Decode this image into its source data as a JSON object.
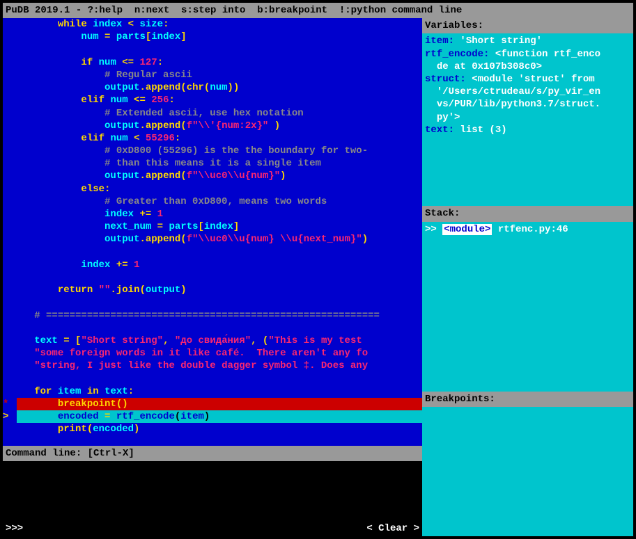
{
  "header": "PuDB 2019.1 - ?:help  n:next  s:step into  b:breakpoint  !:python command line",
  "code": {
    "lines": [
      {
        "indent": "       ",
        "tokens": [
          {
            "c": "kw",
            "t": "while"
          },
          {
            "c": "white",
            "t": " "
          },
          {
            "c": "name",
            "t": "index"
          },
          {
            "c": "white",
            "t": " "
          },
          {
            "c": "op",
            "t": "<"
          },
          {
            "c": "white",
            "t": " "
          },
          {
            "c": "name",
            "t": "size"
          },
          {
            "c": "op",
            "t": ":"
          }
        ]
      },
      {
        "indent": "           ",
        "tokens": [
          {
            "c": "name",
            "t": "num"
          },
          {
            "c": "white",
            "t": " "
          },
          {
            "c": "op",
            "t": "="
          },
          {
            "c": "white",
            "t": " "
          },
          {
            "c": "name",
            "t": "parts"
          },
          {
            "c": "bracket",
            "t": "["
          },
          {
            "c": "name",
            "t": "index"
          },
          {
            "c": "bracket",
            "t": "]"
          }
        ]
      },
      {
        "indent": "",
        "tokens": []
      },
      {
        "indent": "           ",
        "tokens": [
          {
            "c": "kw",
            "t": "if"
          },
          {
            "c": "white",
            "t": " "
          },
          {
            "c": "name",
            "t": "num"
          },
          {
            "c": "white",
            "t": " "
          },
          {
            "c": "op",
            "t": "<="
          },
          {
            "c": "white",
            "t": " "
          },
          {
            "c": "num",
            "t": "127"
          },
          {
            "c": "op",
            "t": ":"
          }
        ]
      },
      {
        "indent": "               ",
        "tokens": [
          {
            "c": "comment",
            "t": "# Regular ascii"
          }
        ]
      },
      {
        "indent": "               ",
        "tokens": [
          {
            "c": "name",
            "t": "output"
          },
          {
            "c": "op",
            "t": "."
          },
          {
            "c": "func",
            "t": "append"
          },
          {
            "c": "paren",
            "t": "("
          },
          {
            "c": "func",
            "t": "chr"
          },
          {
            "c": "paren",
            "t": "("
          },
          {
            "c": "name",
            "t": "num"
          },
          {
            "c": "paren",
            "t": ")"
          },
          {
            "c": "paren",
            "t": ")"
          }
        ]
      },
      {
        "indent": "           ",
        "tokens": [
          {
            "c": "kw",
            "t": "elif"
          },
          {
            "c": "white",
            "t": " "
          },
          {
            "c": "name",
            "t": "num"
          },
          {
            "c": "white",
            "t": " "
          },
          {
            "c": "op",
            "t": "<="
          },
          {
            "c": "white",
            "t": " "
          },
          {
            "c": "num",
            "t": "256"
          },
          {
            "c": "op",
            "t": ":"
          }
        ]
      },
      {
        "indent": "               ",
        "tokens": [
          {
            "c": "comment",
            "t": "# Extended ascii, use hex notation"
          }
        ]
      },
      {
        "indent": "               ",
        "tokens": [
          {
            "c": "name",
            "t": "output"
          },
          {
            "c": "op",
            "t": "."
          },
          {
            "c": "func",
            "t": "append"
          },
          {
            "c": "paren",
            "t": "("
          },
          {
            "c": "str",
            "t": "f\"\\\\'{num:2x}\" "
          },
          {
            "c": "paren",
            "t": ")"
          }
        ]
      },
      {
        "indent": "           ",
        "tokens": [
          {
            "c": "kw",
            "t": "elif"
          },
          {
            "c": "white",
            "t": " "
          },
          {
            "c": "name",
            "t": "num"
          },
          {
            "c": "white",
            "t": " "
          },
          {
            "c": "op",
            "t": "<"
          },
          {
            "c": "white",
            "t": " "
          },
          {
            "c": "num",
            "t": "55296"
          },
          {
            "c": "op",
            "t": ":"
          }
        ]
      },
      {
        "indent": "               ",
        "tokens": [
          {
            "c": "comment",
            "t": "# 0xD800 (55296) is the the boundary for two-"
          }
        ]
      },
      {
        "indent": "               ",
        "tokens": [
          {
            "c": "comment",
            "t": "# than this means it is a single item"
          }
        ]
      },
      {
        "indent": "               ",
        "tokens": [
          {
            "c": "name",
            "t": "output"
          },
          {
            "c": "op",
            "t": "."
          },
          {
            "c": "func",
            "t": "append"
          },
          {
            "c": "paren",
            "t": "("
          },
          {
            "c": "str",
            "t": "f\"\\\\uc0\\\\u{num}\""
          },
          {
            "c": "paren",
            "t": ")"
          }
        ]
      },
      {
        "indent": "           ",
        "tokens": [
          {
            "c": "kw",
            "t": "else"
          },
          {
            "c": "op",
            "t": ":"
          }
        ]
      },
      {
        "indent": "               ",
        "tokens": [
          {
            "c": "comment",
            "t": "# Greater than 0xD800, means two words"
          }
        ]
      },
      {
        "indent": "               ",
        "tokens": [
          {
            "c": "name",
            "t": "index"
          },
          {
            "c": "white",
            "t": " "
          },
          {
            "c": "op",
            "t": "+="
          },
          {
            "c": "white",
            "t": " "
          },
          {
            "c": "num",
            "t": "1"
          }
        ]
      },
      {
        "indent": "               ",
        "tokens": [
          {
            "c": "name",
            "t": "next_num"
          },
          {
            "c": "white",
            "t": " "
          },
          {
            "c": "op",
            "t": "="
          },
          {
            "c": "white",
            "t": " "
          },
          {
            "c": "name",
            "t": "parts"
          },
          {
            "c": "bracket",
            "t": "["
          },
          {
            "c": "name",
            "t": "index"
          },
          {
            "c": "bracket",
            "t": "]"
          }
        ]
      },
      {
        "indent": "               ",
        "tokens": [
          {
            "c": "name",
            "t": "output"
          },
          {
            "c": "op",
            "t": "."
          },
          {
            "c": "func",
            "t": "append"
          },
          {
            "c": "paren",
            "t": "("
          },
          {
            "c": "str",
            "t": "f\"\\\\uc0\\\\u{num} \\\\u{next_num}\""
          },
          {
            "c": "paren",
            "t": ")"
          }
        ]
      },
      {
        "indent": "",
        "tokens": []
      },
      {
        "indent": "           ",
        "tokens": [
          {
            "c": "name",
            "t": "index"
          },
          {
            "c": "white",
            "t": " "
          },
          {
            "c": "op",
            "t": "+="
          },
          {
            "c": "white",
            "t": " "
          },
          {
            "c": "num",
            "t": "1"
          }
        ]
      },
      {
        "indent": "",
        "tokens": []
      },
      {
        "indent": "       ",
        "tokens": [
          {
            "c": "kw",
            "t": "return"
          },
          {
            "c": "white",
            "t": " "
          },
          {
            "c": "str",
            "t": "\"\""
          },
          {
            "c": "op",
            "t": "."
          },
          {
            "c": "func",
            "t": "join"
          },
          {
            "c": "paren",
            "t": "("
          },
          {
            "c": "name",
            "t": "output"
          },
          {
            "c": "paren",
            "t": ")"
          }
        ]
      },
      {
        "indent": "",
        "tokens": []
      },
      {
        "indent": "   ",
        "tokens": [
          {
            "c": "comment",
            "t": "# ========================================================="
          }
        ]
      },
      {
        "indent": "",
        "tokens": []
      },
      {
        "indent": "   ",
        "tokens": [
          {
            "c": "name",
            "t": "text"
          },
          {
            "c": "white",
            "t": " "
          },
          {
            "c": "op",
            "t": "="
          },
          {
            "c": "white",
            "t": " "
          },
          {
            "c": "bracket",
            "t": "["
          },
          {
            "c": "str",
            "t": "\"Short string\""
          },
          {
            "c": "op",
            "t": ","
          },
          {
            "c": "white",
            "t": " "
          },
          {
            "c": "str",
            "t": "\"до свида́ния\""
          },
          {
            "c": "op",
            "t": ","
          },
          {
            "c": "white",
            "t": " "
          },
          {
            "c": "paren",
            "t": "("
          },
          {
            "c": "str",
            "t": "\"This is my test "
          }
        ]
      },
      {
        "indent": "   ",
        "tokens": [
          {
            "c": "str",
            "t": "\"some foreign words in it like café.  There aren't any fo"
          }
        ]
      },
      {
        "indent": "   ",
        "tokens": [
          {
            "c": "str",
            "t": "\"string, I just like the double dagger symbol ‡. Does any"
          }
        ]
      },
      {
        "indent": "",
        "tokens": []
      },
      {
        "indent": "   ",
        "tokens": [
          {
            "c": "kw",
            "t": "for"
          },
          {
            "c": "white",
            "t": " "
          },
          {
            "c": "name",
            "t": "item"
          },
          {
            "c": "white",
            "t": " "
          },
          {
            "c": "kw",
            "t": "in"
          },
          {
            "c": "white",
            "t": " "
          },
          {
            "c": "name",
            "t": "text"
          },
          {
            "c": "op",
            "t": ":"
          }
        ]
      },
      {
        "indent": "       ",
        "gutter": "*",
        "gclass": "gutter-bp",
        "lineclass": "line-bp",
        "tokens": [
          {
            "c": "func",
            "t": "breakpoint"
          },
          {
            "c": "paren",
            "t": "()"
          }
        ]
      },
      {
        "indent": "       ",
        "gutter": ">",
        "gclass": "gutter-cur",
        "lineclass": "line-cur",
        "tokens": [
          {
            "c": "name",
            "t": "encoded"
          },
          {
            "c": "white",
            "t": " "
          },
          {
            "c": "op",
            "t": "="
          },
          {
            "c": "white",
            "t": " "
          },
          {
            "c": "name",
            "t": "rtf_encode"
          },
          {
            "c": "paren",
            "t": "("
          },
          {
            "c": "name",
            "t": "item"
          },
          {
            "c": "paren",
            "t": ")"
          }
        ]
      },
      {
        "indent": "       ",
        "tokens": [
          {
            "c": "func",
            "t": "print"
          },
          {
            "c": "paren",
            "t": "("
          },
          {
            "c": "name",
            "t": "encoded"
          },
          {
            "c": "paren",
            "t": ")"
          }
        ]
      }
    ]
  },
  "cmdline": "Command line: [Ctrl-X]",
  "console": {
    "prompt": ">>>",
    "clear": "< Clear >"
  },
  "vars": {
    "title": "Variables:",
    "items": [
      {
        "name": "item:",
        "val": " 'Short string'"
      },
      {
        "name": "rtf_encode:",
        "val": " <function rtf_enco\n  de at 0x107b308c0>"
      },
      {
        "name": "struct:",
        "val": " <module 'struct' from\n  '/Users/ctrudeau/s/py_vir_en\n  vs/PUR/lib/python3.7/struct.\n  py'>"
      },
      {
        "name": "text:",
        "val": " list (3)"
      }
    ]
  },
  "stack": {
    "title": "Stack:",
    "frames": [
      {
        "marker": ">> ",
        "mod": "<module>",
        "loc": " rtfenc.py:46"
      }
    ]
  },
  "breakpoints": {
    "title": "Breakpoints:"
  }
}
